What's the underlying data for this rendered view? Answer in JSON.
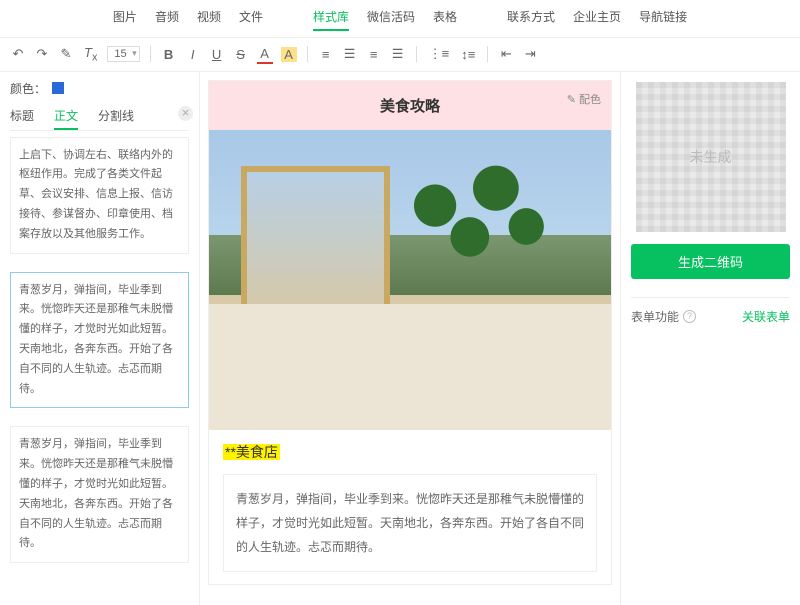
{
  "topbar": {
    "items": [
      "图片",
      "音频",
      "视频",
      "文件",
      "样式库",
      "微信活码",
      "表格",
      "联系方式",
      "企业主页",
      "导航链接"
    ],
    "active_index": 4
  },
  "toolbar": {
    "font_size": "15",
    "bold": "B",
    "italic": "I",
    "underline": "U",
    "strike": "S",
    "fontcolor": "A",
    "bgcolor": "A"
  },
  "left": {
    "color_label": "颜色：",
    "tabs": [
      "标题",
      "正文",
      "分割线"
    ],
    "active_tab": 1,
    "cards": [
      "上启下、协调左右、联络内外的枢纽作用。完成了各类文件起草、会议安排、信息上报、信访接待、参谋督办、印章使用、档案存放以及其他服务工作。",
      "青葱岁月，弹指间，毕业季到来。恍惚昨天还是那稚气未脱懵懂的样子，才觉时光如此短暂。天南地北，各奔东西。开始了各自不同的人生轨迹。忐忑而期待。",
      "青葱岁月，弹指间，毕业季到来。恍惚昨天还是那稚气未脱懵懂的样子，才觉时光如此短暂。天南地北，各奔东西。开始了各自不同的人生轨迹。忐忑而期待。"
    ]
  },
  "doc": {
    "title": "美食攻略",
    "config": "配色",
    "tag": "**美食店",
    "quote": "青葱岁月，弹指间，毕业季到来。恍惚昨天还是那稚气未脱懵懂的样子，才觉时光如此短暂。天南地北，各奔东西。开始了各自不同的人生轨迹。忐忑而期待。"
  },
  "right": {
    "qr_placeholder": "未生成",
    "gen_btn": "生成二维码",
    "form_label": "表单功能",
    "form_link": "关联表单"
  }
}
